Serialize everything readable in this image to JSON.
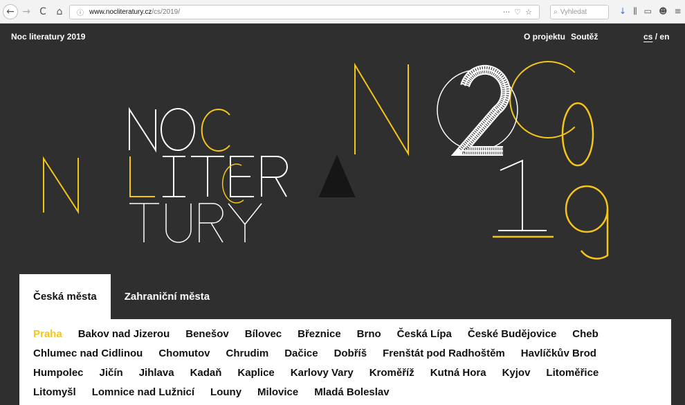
{
  "browser": {
    "nav_back": "←",
    "nav_forward": "→",
    "nav_reload": "C",
    "nav_home": "⌂",
    "url_info_icon": "ⓘ",
    "url_domain": "www.nocliteratury.cz",
    "url_path": "/cs/2019/",
    "url_actions": [
      "···",
      "♡",
      "☆"
    ],
    "search_placeholder": "Vyhledat",
    "search_icon": "search-icon",
    "tool_icons": [
      "↓",
      "⫼",
      "▭",
      "☻",
      "≡"
    ]
  },
  "header": {
    "site_title": "Noc literatury 2019",
    "nav": [
      "O projektu",
      "Soutěž"
    ],
    "lang_cs": "cs",
    "lang_separator": "/",
    "lang_en": "en"
  },
  "hero": {
    "logo_lines": [
      "NOC",
      "LITERA",
      "TURY"
    ],
    "year_digits": [
      "2",
      "0",
      "1",
      "9"
    ],
    "colors": {
      "accent": "#f5c518",
      "white": "#ffffff",
      "background": "#2f2f2f",
      "dark": "#161616"
    }
  },
  "tabs": [
    {
      "label": "Česká města",
      "active": true
    },
    {
      "label": "Zahraniční města",
      "active": false
    }
  ],
  "cities": [
    "Praha",
    "Bakov nad Jizerou",
    "Benešov",
    "Bílovec",
    "Březnice",
    "Brno",
    "Česká Lípa",
    "České Budějovice",
    "Cheb",
    "Chlumec nad Cidlinou",
    "Chomutov",
    "Chrudim",
    "Dačice",
    "Dobříš",
    "Frenštát pod Radhoštěm",
    "Havlíčkův Brod",
    "Humpolec",
    "Jičín",
    "Jihlava",
    "Kadaň",
    "Kaplice",
    "Karlovy Vary",
    "Kroměříž",
    "Kutná Hora",
    "Kyjov",
    "Litoměřice",
    "Litomyšl",
    "Lomnice nad Lužnicí",
    "Louny",
    "Milovice",
    "Mladá Boleslav"
  ],
  "active_city": "Praha"
}
